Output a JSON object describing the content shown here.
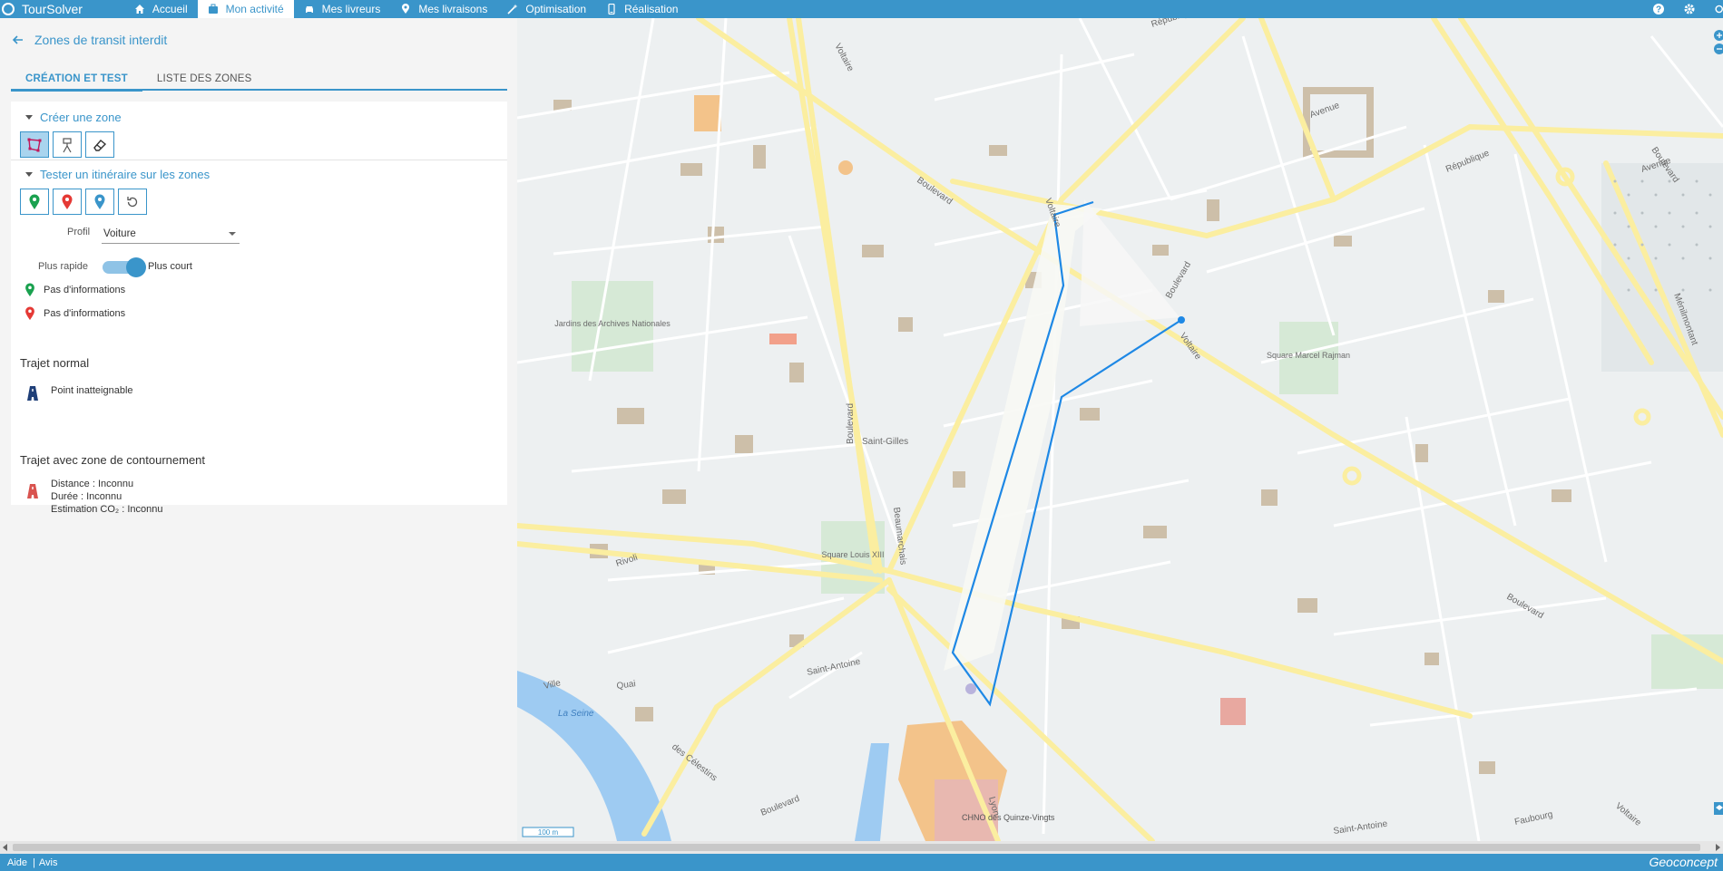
{
  "app": {
    "name": "TourSolver"
  },
  "nav": {
    "items": [
      {
        "label": "Accueil",
        "icon": "home-icon"
      },
      {
        "label": "Mon activité",
        "icon": "briefcase-icon",
        "active": true
      },
      {
        "label": "Mes livreurs",
        "icon": "car-icon"
      },
      {
        "label": "Mes livraisons",
        "icon": "location-pin-icon"
      },
      {
        "label": "Optimisation",
        "icon": "magic-wand-icon"
      },
      {
        "label": "Réalisation",
        "icon": "phone-icon"
      }
    ],
    "accent": "#3a95ca"
  },
  "panel": {
    "title": "Zones de transit interdit",
    "tabs": [
      {
        "label": "CRÉATION ET TEST",
        "active": true
      },
      {
        "label": "LISTE DES ZONES"
      }
    ],
    "create_section": {
      "title": "Créer une zone"
    },
    "test_section": {
      "title": "Tester un itinéraire sur les zones"
    },
    "profile": {
      "label": "Profil",
      "value": "Voiture"
    },
    "toggle": {
      "left_label": "Plus rapide",
      "right_label": "Plus court"
    },
    "start_info": "Pas d'informations",
    "end_info": "Pas d'informations",
    "normal": {
      "title": "Trajet normal",
      "status": "Point inatteignable"
    },
    "avoid": {
      "title": "Trajet avec zone de contournement",
      "distance": "Distance : Inconnu",
      "duration": "Durée : Inconnu",
      "co2": "Estimation CO₂  : Inconnu"
    }
  },
  "map": {
    "labels": {
      "voltaire": "Voltaire",
      "boulevard": "Boulevard",
      "republique": "République",
      "avenue": "Avenue",
      "beaumarchais": "Beaumarchais",
      "saint_antoine": "Saint-Antoine",
      "rivoli": "Rivoli",
      "saint_gilles": "Saint-Gilles",
      "jardins": "Jardins des Archives Nationales",
      "square_louis": "Square Louis XIII",
      "square_marcel": "Square Marcel Rajman",
      "quai": "Quai",
      "des_celestins": "des Célestins",
      "la_seine": "La Seine",
      "ville": "Ville",
      "lyon": "Lyon",
      "faubourg": "Faubourg",
      "menilmontant": "Ménilmontant",
      "chno": "CHNO des Quinze-Vingts",
      "scale": "100 m"
    }
  },
  "footer": {
    "help": "Aide",
    "notice": "Avis",
    "brand": "Geoconcept"
  }
}
